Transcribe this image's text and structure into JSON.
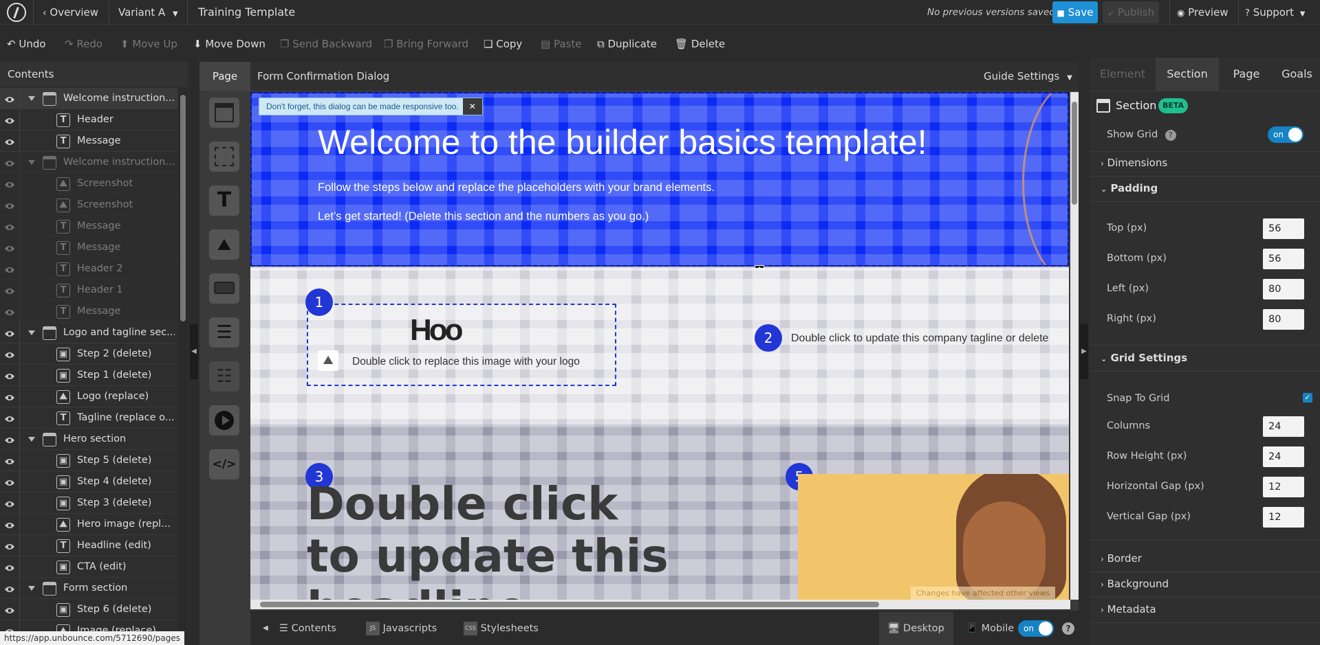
{
  "topbar": {
    "overview": "Overview",
    "variant": "Variant A",
    "title": "Training Template",
    "versions": "No previous versions saved",
    "save": "Save",
    "publish": "Publish",
    "preview": "Preview",
    "support": "Support"
  },
  "toolbar": {
    "undo": "Undo",
    "redo": "Redo",
    "move_up": "Move Up",
    "move_down": "Move Down",
    "send_backward": "Send Backward",
    "bring_forward": "Bring Forward",
    "copy": "Copy",
    "paste": "Paste",
    "duplicate": "Duplicate",
    "delete": "Delete"
  },
  "contents": {
    "title": "Contents",
    "items": [
      {
        "label": "Welcome instruction...",
        "type": "section",
        "dim": false
      },
      {
        "label": "Header",
        "type": "text",
        "dim": false
      },
      {
        "label": "Message",
        "type": "text",
        "dim": false
      },
      {
        "label": "Welcome instruction...",
        "type": "section",
        "dim": true
      },
      {
        "label": "Screenshot",
        "type": "image",
        "dim": true
      },
      {
        "label": "Screenshot",
        "type": "image",
        "dim": true
      },
      {
        "label": "Message",
        "type": "text",
        "dim": true
      },
      {
        "label": "Message",
        "type": "text",
        "dim": true
      },
      {
        "label": "Header 2",
        "type": "text",
        "dim": true
      },
      {
        "label": "Header 1",
        "type": "text",
        "dim": true
      },
      {
        "label": "Message",
        "type": "text",
        "dim": true
      },
      {
        "label": "Logo and tagline sec...",
        "type": "section",
        "dim": false
      },
      {
        "label": "Step 2 (delete)",
        "type": "step",
        "dim": false
      },
      {
        "label": "Step 1 (delete)",
        "type": "step",
        "dim": false
      },
      {
        "label": "Logo (replace)",
        "type": "image",
        "dim": false
      },
      {
        "label": "Tagline (replace o...",
        "type": "text",
        "dim": false
      },
      {
        "label": "Hero section",
        "type": "section",
        "dim": false
      },
      {
        "label": "Step 5 (delete)",
        "type": "step",
        "dim": false
      },
      {
        "label": "Step 4 (delete)",
        "type": "step",
        "dim": false
      },
      {
        "label": "Step 3 (delete)",
        "type": "step",
        "dim": false
      },
      {
        "label": "Hero image (repl...",
        "type": "image",
        "dim": false
      },
      {
        "label": "Headline (edit)",
        "type": "text",
        "dim": false
      },
      {
        "label": "CTA (edit)",
        "type": "step",
        "dim": false
      },
      {
        "label": "Form section",
        "type": "section",
        "dim": false
      },
      {
        "label": "Step 6 (delete)",
        "type": "step",
        "dim": false
      },
      {
        "label": "Image (replace)",
        "type": "image",
        "dim": false
      }
    ]
  },
  "canvas": {
    "page_tab": "Page",
    "dialog_name": "Form Confirmation Dialog",
    "guide_settings": "Guide Settings",
    "tooltip": "Don't forget, this dialog can be made responsive too.",
    "welcome_title": "Welcome to the builder basics template!",
    "welcome_line1": "Follow the steps below and replace the placeholders with your brand elements.",
    "welcome_line2": "Let’s get started! (Delete this section and the numbers as you go.)",
    "step1": "1",
    "step2": "2",
    "step3": "3",
    "step5": "5",
    "logo_hint": "Double click to replace this image with your logo",
    "tagline_hint": "Double click to update this company tagline or delete",
    "headline": "Double click to update this headline",
    "changes_note": "Changes have affected other views",
    "status_url": "https://app.unbounce.com/5712690/pages"
  },
  "bottombar": {
    "contents": "Contents",
    "javascripts": "Javascripts",
    "stylesheets": "Stylesheets",
    "desktop": "Desktop",
    "mobile": "Mobile",
    "mobile_toggle": "on"
  },
  "right": {
    "tabs": [
      "Element",
      "Section",
      "Page",
      "Goals"
    ],
    "section_title": "Section",
    "beta": "BETA",
    "show_grid": "Show Grid",
    "show_grid_toggle": "on",
    "dimensions": "Dimensions",
    "padding": "Padding",
    "top_label": "Top (px)",
    "top_val": "56",
    "bottom_label": "Bottom (px)",
    "bottom_val": "56",
    "left_label": "Left (px)",
    "left_val": "80",
    "right_label": "Right (px)",
    "right_val": "80",
    "grid_settings": "Grid Settings",
    "snap": "Snap To Grid",
    "columns_label": "Columns",
    "columns_val": "24",
    "row_height_label": "Row Height (px)",
    "row_height_val": "24",
    "hgap_label": "Horizontal Gap (px)",
    "hgap_val": "12",
    "vgap_label": "Vertical Gap (px)",
    "vgap_val": "12",
    "border": "Border",
    "background": "Background",
    "metadata": "Metadata"
  },
  "colors": {
    "accent": "#1583c4",
    "hero_blue": "#0b2bf5",
    "step_blue": "#2236d6"
  }
}
